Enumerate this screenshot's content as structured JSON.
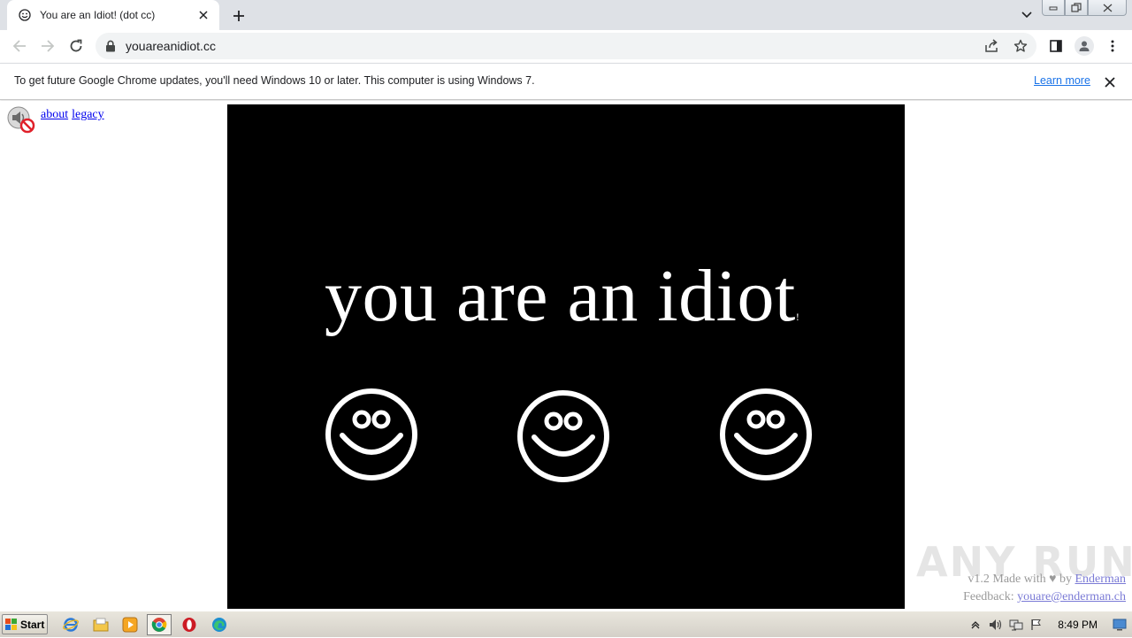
{
  "browser": {
    "tab": {
      "title": "You are an Idiot! (dot cc)",
      "favicon": "smiley-icon"
    },
    "address": {
      "url": "youareanidiot.cc"
    }
  },
  "infobar": {
    "message": "To get future Google Chrome updates, you'll need Windows 10 or later. This computer is using Windows 7.",
    "link": "Learn more"
  },
  "page": {
    "nav_links": [
      "about",
      "legacy"
    ],
    "headline": "you are an idiot",
    "headline_trail": "!",
    "footer": {
      "version": "v1.2",
      "made_with": "Made with",
      "by": "by",
      "author": "Enderman",
      "feedback_label": "Feedback:",
      "feedback_email": "youare@enderman.ch"
    },
    "watermark": "ANY RUN"
  },
  "taskbar": {
    "start_label": "Start",
    "clock": "8:49 PM"
  },
  "colors": {
    "stage_bg": "#000000",
    "headline": "#ffffff",
    "link": "#0000ee",
    "chrome_tabstrip": "#dee1e6",
    "chrome_link": "#1a73e8"
  }
}
